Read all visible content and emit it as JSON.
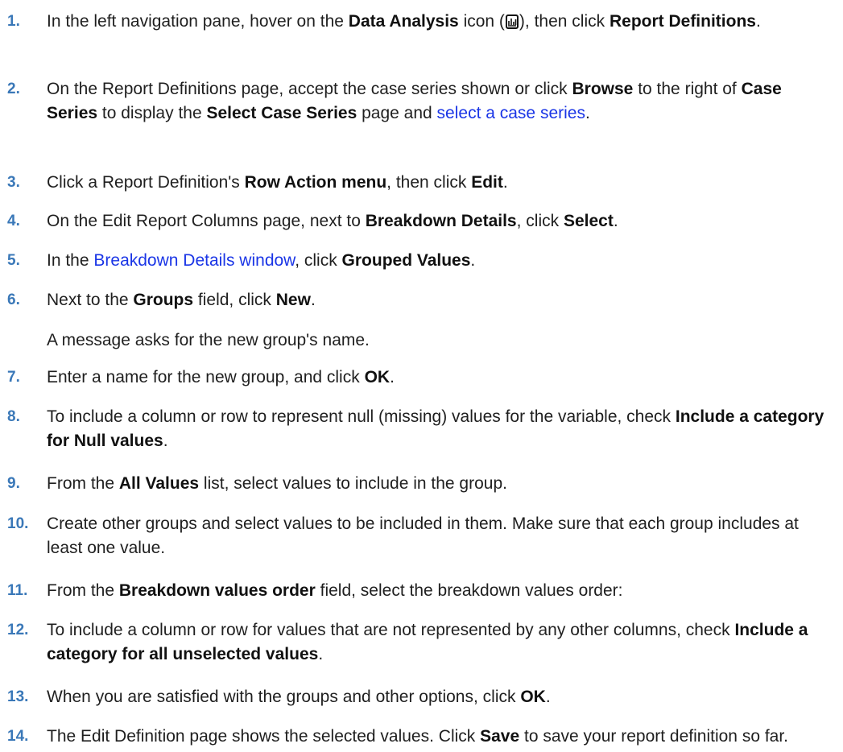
{
  "steps": [
    {
      "num": "1.",
      "parts": [
        {
          "t": "In the left navigation pane, hover on the "
        },
        {
          "t": "Data Analysis",
          "b": true
        },
        {
          "t": " icon ("
        },
        {
          "icon": "data-analysis-icon"
        },
        {
          "t": "), then click "
        },
        {
          "t": "Report Definitions",
          "b": true
        },
        {
          "t": "."
        }
      ]
    },
    {
      "num": "2.",
      "parts": [
        {
          "t": "On the Report Definitions page, accept the case series shown or click "
        },
        {
          "t": "Browse",
          "b": true
        },
        {
          "t": " to the right of "
        },
        {
          "t": "Case Series",
          "b": true
        },
        {
          "t": " to display the "
        },
        {
          "t": "Select Case Series",
          "b": true
        },
        {
          "t": " page and "
        },
        {
          "t": "select a case series",
          "link": true
        },
        {
          "t": "."
        }
      ]
    },
    {
      "num": "3.",
      "parts": [
        {
          "t": "Click a Report Definition's "
        },
        {
          "t": "Row Action menu",
          "b": true
        },
        {
          "t": ", then click "
        },
        {
          "t": "Edit",
          "b": true
        },
        {
          "t": "."
        }
      ]
    },
    {
      "num": "4.",
      "parts": [
        {
          "t": "On the Edit Report Columns page, next to "
        },
        {
          "t": "Breakdown Details",
          "b": true
        },
        {
          "t": ", click "
        },
        {
          "t": "Select",
          "b": true
        },
        {
          "t": "."
        }
      ]
    },
    {
      "num": "5.",
      "parts": [
        {
          "t": "In the "
        },
        {
          "t": "Breakdown Details window",
          "link": true
        },
        {
          "t": ", click "
        },
        {
          "t": "Grouped Values",
          "b": true
        },
        {
          "t": "."
        }
      ]
    },
    {
      "num": "6.",
      "parts": [
        {
          "t": "Next to the "
        },
        {
          "t": "Groups",
          "b": true
        },
        {
          "t": " field, click "
        },
        {
          "t": "New",
          "b": true
        },
        {
          "t": "."
        }
      ],
      "note": "A message asks for the new group's name."
    },
    {
      "num": "7.",
      "parts": [
        {
          "t": "Enter a name for the new group, and click "
        },
        {
          "t": "OK",
          "b": true
        },
        {
          "t": "."
        }
      ]
    },
    {
      "num": "8.",
      "parts": [
        {
          "t": "To include a column or row to represent null (missing) values for the variable, check "
        },
        {
          "t": "Include a category for Null values",
          "b": true
        },
        {
          "t": "."
        }
      ]
    },
    {
      "num": "9.",
      "parts": [
        {
          "t": "From the "
        },
        {
          "t": "All Values",
          "b": true
        },
        {
          "t": " list, select values to include in the group."
        }
      ]
    },
    {
      "num": "10.",
      "parts": [
        {
          "t": "Create other groups and select values to be included in them. Make sure that each group includes at least one value."
        }
      ]
    },
    {
      "num": "11.",
      "parts": [
        {
          "t": "From the "
        },
        {
          "t": "Breakdown values order",
          "b": true
        },
        {
          "t": " field, select the breakdown values order:"
        }
      ]
    },
    {
      "num": "12.",
      "parts": [
        {
          "t": "To include a column or row for values that are not represented by any other columns, check "
        },
        {
          "t": "Include a category for all unselected values",
          "b": true
        },
        {
          "t": "."
        }
      ]
    },
    {
      "num": "13.",
      "parts": [
        {
          "t": "When you are satisfied with the groups and other options, click "
        },
        {
          "t": "OK",
          "b": true
        },
        {
          "t": "."
        }
      ]
    },
    {
      "num": "14.",
      "parts": [
        {
          "t": "The Edit Definition page shows the selected values. Click "
        },
        {
          "t": "Save",
          "b": true
        },
        {
          "t": " to save your report definition so far."
        }
      ]
    }
  ],
  "colors": {
    "step_number": "#3a78b8",
    "link": "#1a35e6",
    "text": "#1f1f1f"
  }
}
